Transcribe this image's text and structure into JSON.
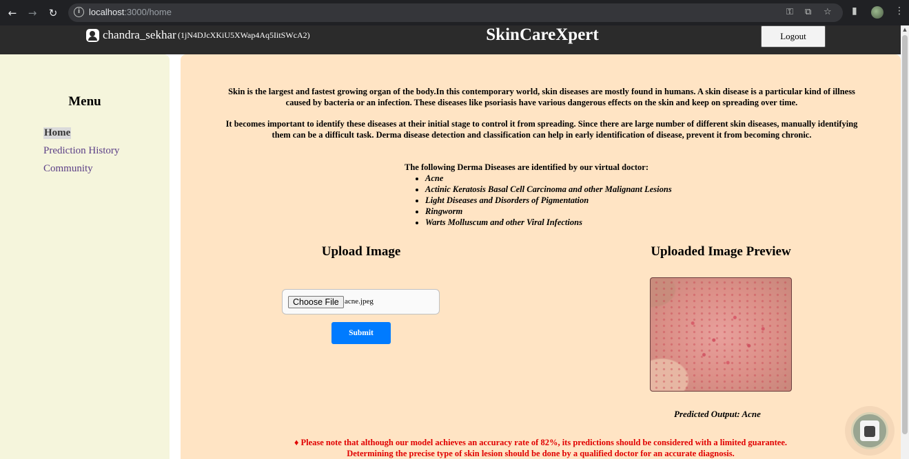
{
  "browser": {
    "url_host": "localhost",
    "url_rest": ":3000/home",
    "back_icon": "←",
    "forward_icon": "→",
    "reload_icon": "↻",
    "info_icon": "i",
    "key_icon": "⚿",
    "install_icon": "⧉",
    "star_icon": "☆",
    "sidepanel_icon": "▮",
    "menu_icon": "⋮"
  },
  "header": {
    "username": "chandra_sekhar",
    "user_id": "(1jN4DJcXKiU5XWap4Aq5IitSWcA2)",
    "brand": "SkinCareXpert",
    "logout_label": "Logout"
  },
  "sidebar": {
    "title": "Menu",
    "items": [
      {
        "label": "Home",
        "active": true
      },
      {
        "label": "Prediction History",
        "active": false
      },
      {
        "label": "Community",
        "active": false
      }
    ]
  },
  "main": {
    "paragraph1": "Skin is the largest and fastest growing organ of the body.In this contemporary world, skin diseases are mostly found in humans. A skin disease is a particular kind of illness caused by bacteria or an infection. These diseases like psoriasis have various dangerous effects on the skin and keep on spreading over time.",
    "paragraph2": "It becomes important to identify these diseases at their initial stage to control it from spreading. Since there are large number of different skin diseases, manually identifying them can be a difficult task. Derma disease detection and classification can help in early identification of disease, prevent it from becoming chronic.",
    "diseases_heading": "The following Derma Diseases are identified by our virtual doctor:",
    "diseases": [
      "Acne",
      "Actinic Keratosis Basal Cell Carcinoma and other Malignant Lesions",
      "Light Diseases and Disorders of Pigmentation",
      "Ringworm",
      "Warts Molluscum and other Viral Infections"
    ],
    "upload_title": "Upload Image",
    "choose_file_label": "Choose File",
    "file_name": "acne.jpeg",
    "submit_label": "Submit",
    "preview_title": "Uploaded Image Preview",
    "predicted_output": "Predicted Output: Acne",
    "disclaimer_line1": "♦ Please note that although our model achieves an accuracy rate of 82%, its predictions should be considered with a limited guarantee.",
    "disclaimer_line2": "Determining the precise type of skin lesion should be done by a qualified doctor for an accurate diagnosis."
  },
  "colors": {
    "header_bg": "#2b2b2b",
    "sidebar_bg": "#f5f5dc",
    "main_bg": "#ffe4c4",
    "link": "#5b3f87",
    "submit": "#007bff",
    "disclaimer": "#e00000"
  }
}
